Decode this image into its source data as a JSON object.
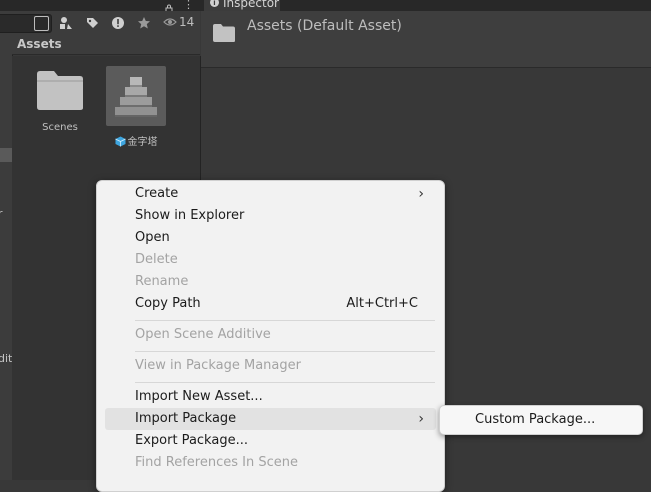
{
  "toolbar": {
    "filter_count": "14",
    "icons": [
      "search-icon",
      "filter-by-type-icon",
      "filter-by-label-icon",
      "error-toggle-icon",
      "favorite-icon",
      "visibility-icon"
    ]
  },
  "window": {
    "lock_icon": "lock-icon",
    "menu_icon": "kebab-menu-icon"
  },
  "left_strip": {
    "fragment_1": "r",
    "fragment_2": "dit"
  },
  "assets": {
    "header": "Assets",
    "items": [
      {
        "label": "Scenes",
        "icon": "folder-icon"
      },
      {
        "label": "金字塔",
        "icon": "pyramid-prefab-icon"
      }
    ]
  },
  "inspector": {
    "tab_label": "Inspector",
    "title": "Assets (Default Asset)"
  },
  "context_menu": {
    "items": [
      {
        "label": "Create",
        "submenu": true,
        "disabled": false
      },
      {
        "label": "Show in Explorer",
        "disabled": false
      },
      {
        "label": "Open",
        "disabled": false
      },
      {
        "label": "Delete",
        "disabled": true
      },
      {
        "label": "Rename",
        "disabled": true
      },
      {
        "label": "Copy Path",
        "shortcut": "Alt+Ctrl+C",
        "disabled": false
      },
      {
        "label": "Open Scene Additive",
        "disabled": true
      },
      {
        "label": "View in Package Manager",
        "disabled": true
      },
      {
        "label": "Import New Asset...",
        "disabled": false
      },
      {
        "label": "Import Package",
        "submenu": true,
        "disabled": false,
        "highlighted": true
      },
      {
        "label": "Export Package...",
        "disabled": false
      },
      {
        "label": "Find References In Scene",
        "disabled": true
      }
    ],
    "submenu_items": [
      {
        "label": "Custom Package..."
      }
    ]
  }
}
